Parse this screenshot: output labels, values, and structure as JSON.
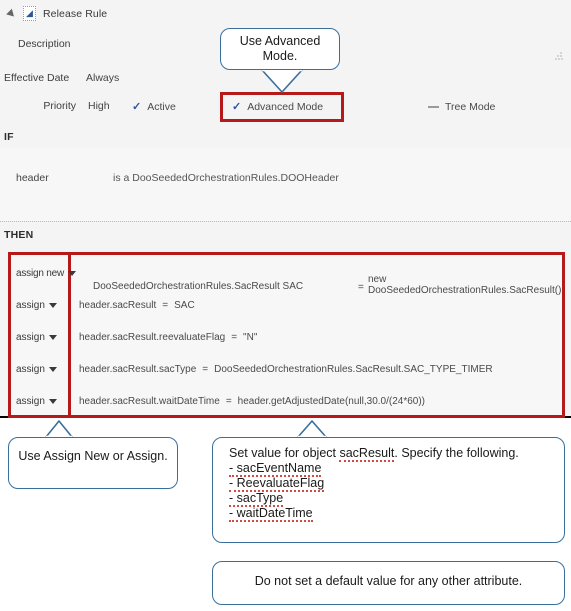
{
  "panel": {
    "title": "Release Rule",
    "icon": "rule-document-icon",
    "fields": {
      "description_label": "Description",
      "description_value": "",
      "effective_date_label": "Effective Date",
      "effective_date_value": "Always",
      "priority_label": "Priority",
      "priority_value": "High"
    },
    "toggles": [
      {
        "label": "Active",
        "state": "checked",
        "mark": "✓"
      },
      {
        "label": "Advanced Mode",
        "state": "checked",
        "mark": "✓"
      },
      {
        "label": "Tree Mode",
        "state": "indeterminate",
        "mark": "—"
      }
    ]
  },
  "if_section": {
    "label": "IF",
    "clause_term": "header",
    "clause_expression": "is a DooSeededOrchestrationRules.DOOHeader"
  },
  "then_section": {
    "label": "THEN",
    "actions": [
      {
        "operator": "assign new",
        "type_and_var": "DooSeededOrchestrationRules.SacResult   SAC",
        "equals": "=",
        "rhs_line1": "new",
        "rhs_line2": "DooSeededOrchestrationRules.SacResult()"
      },
      {
        "operator": "assign",
        "lhs": "header.sacResult",
        "equals": "=",
        "rhs": "SAC"
      },
      {
        "operator": "assign",
        "lhs": "header.sacResult.reevaluateFlag",
        "equals": "=",
        "rhs": "\"N\""
      },
      {
        "operator": "assign",
        "lhs": "header.sacResult.sacType",
        "equals": "=",
        "rhs": "DooSeededOrchestrationRules.SacResult.SAC_TYPE_TIMER"
      },
      {
        "operator": "assign",
        "lhs": "header.sacResult.waitDateTime",
        "equals": "=",
        "rhs": "header.getAdjustedDate(null,30.0/(24*60))"
      }
    ]
  },
  "callouts": {
    "advanced_mode": "Use Advanced Mode.",
    "assign": "Use Assign New or Assign.",
    "set_value": {
      "heading_before": "Set value for object ",
      "heading_term": "sacResult",
      "heading_after": ". Specify the following.",
      "items": [
        "- sacEventName",
        "- ReevaluateFlag",
        "- sacType",
        "- waitDateTime"
      ]
    },
    "default_value": "Do not set a default value for any other attribute."
  },
  "colors": {
    "highlight_red": "#b51919",
    "callout_blue": "#3a6f9c",
    "check_blue": "#2a5699",
    "panel_background": "#f4f4f4",
    "clause_background": "#f7f7f7"
  }
}
